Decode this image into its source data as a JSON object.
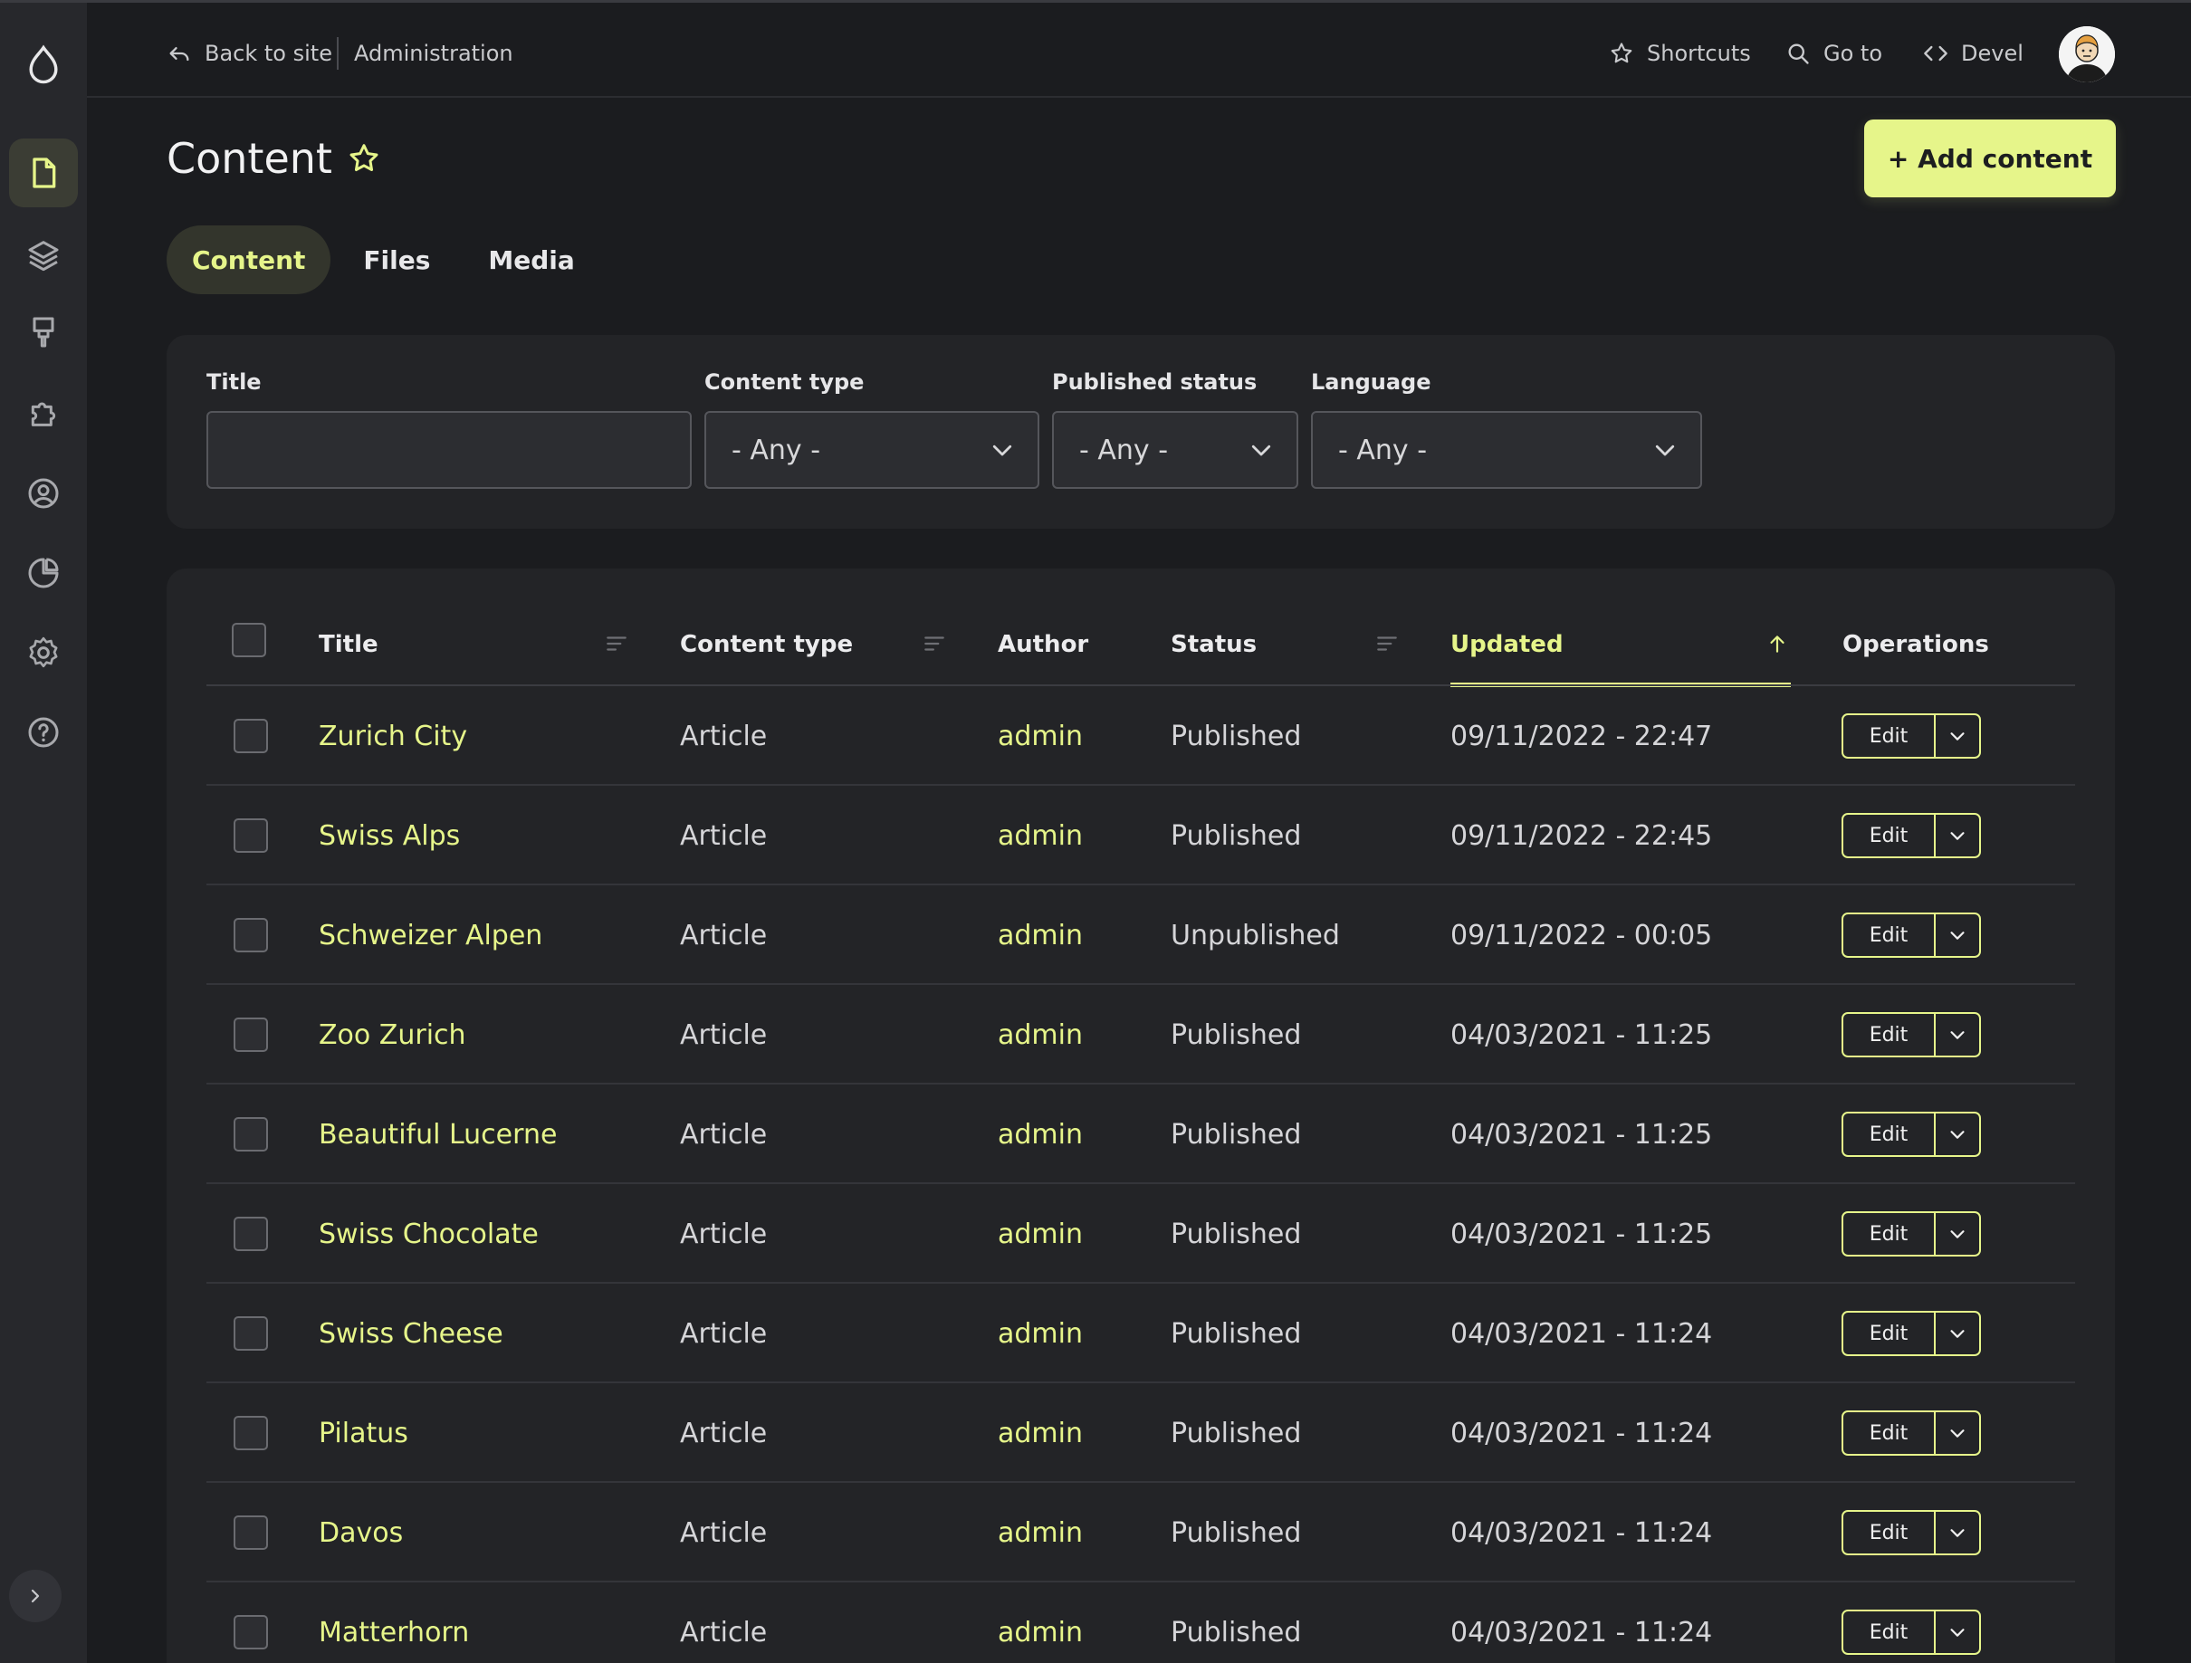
{
  "colors": {
    "accent": "#e6f58a",
    "background": "#1b1c1f",
    "sidebar": "#27282c",
    "panel": "#232427"
  },
  "sidebar": {
    "logo_icon": "drupal-drop-icon",
    "items": [
      {
        "icon": "document-icon",
        "active": true
      },
      {
        "icon": "layers-icon",
        "active": false
      },
      {
        "icon": "paintbrush-icon",
        "active": false
      },
      {
        "icon": "puzzle-icon",
        "active": false
      },
      {
        "icon": "user-icon",
        "active": false
      },
      {
        "icon": "pie-chart-icon",
        "active": false
      },
      {
        "icon": "gear-icon",
        "active": false
      },
      {
        "icon": "help-icon",
        "active": false
      }
    ],
    "expand_icon": "chevron-right-icon"
  },
  "topbar": {
    "back_label": "Back to site",
    "admin_label": "Administration",
    "shortcuts_label": "Shortcuts",
    "goto_label": "Go to",
    "devel_label": "Devel"
  },
  "page": {
    "title": "Content",
    "add_button": "+ Add content"
  },
  "tabs": [
    {
      "label": "Content",
      "active": true
    },
    {
      "label": "Files",
      "active": false
    },
    {
      "label": "Media",
      "active": false
    }
  ],
  "filters": {
    "title_label": "Title",
    "title_value": "",
    "content_type_label": "Content type",
    "content_type_value": "- Any -",
    "status_label": "Published status",
    "status_value": "- Any -",
    "language_label": "Language",
    "language_value": "- Any -"
  },
  "table": {
    "columns": {
      "title": "Title",
      "content_type": "Content type",
      "author": "Author",
      "status": "Status",
      "updated": "Updated",
      "operations": "Operations"
    },
    "edit_label": "Edit",
    "rows": [
      {
        "title": "Zurich City",
        "type": "Article",
        "author": "admin",
        "status": "Published",
        "updated": "09/11/2022 - 22:47"
      },
      {
        "title": "Swiss Alps",
        "type": "Article",
        "author": "admin",
        "status": "Published",
        "updated": "09/11/2022 - 22:45"
      },
      {
        "title": "Schweizer Alpen",
        "type": "Article",
        "author": "admin",
        "status": "Unpublished",
        "updated": "09/11/2022 - 00:05"
      },
      {
        "title": "Zoo Zurich",
        "type": "Article",
        "author": "admin",
        "status": "Published",
        "updated": "04/03/2021 - 11:25"
      },
      {
        "title": "Beautiful Lucerne",
        "type": "Article",
        "author": "admin",
        "status": "Published",
        "updated": "04/03/2021 - 11:25"
      },
      {
        "title": "Swiss Chocolate",
        "type": "Article",
        "author": "admin",
        "status": "Published",
        "updated": "04/03/2021 - 11:25"
      },
      {
        "title": "Swiss Cheese",
        "type": "Article",
        "author": "admin",
        "status": "Published",
        "updated": "04/03/2021 - 11:24"
      },
      {
        "title": "Pilatus",
        "type": "Article",
        "author": "admin",
        "status": "Published",
        "updated": "04/03/2021 - 11:24"
      },
      {
        "title": "Davos",
        "type": "Article",
        "author": "admin",
        "status": "Published",
        "updated": "04/03/2021 - 11:24"
      },
      {
        "title": "Matterhorn",
        "type": "Article",
        "author": "admin",
        "status": "Published",
        "updated": "04/03/2021 - 11:24"
      }
    ]
  }
}
